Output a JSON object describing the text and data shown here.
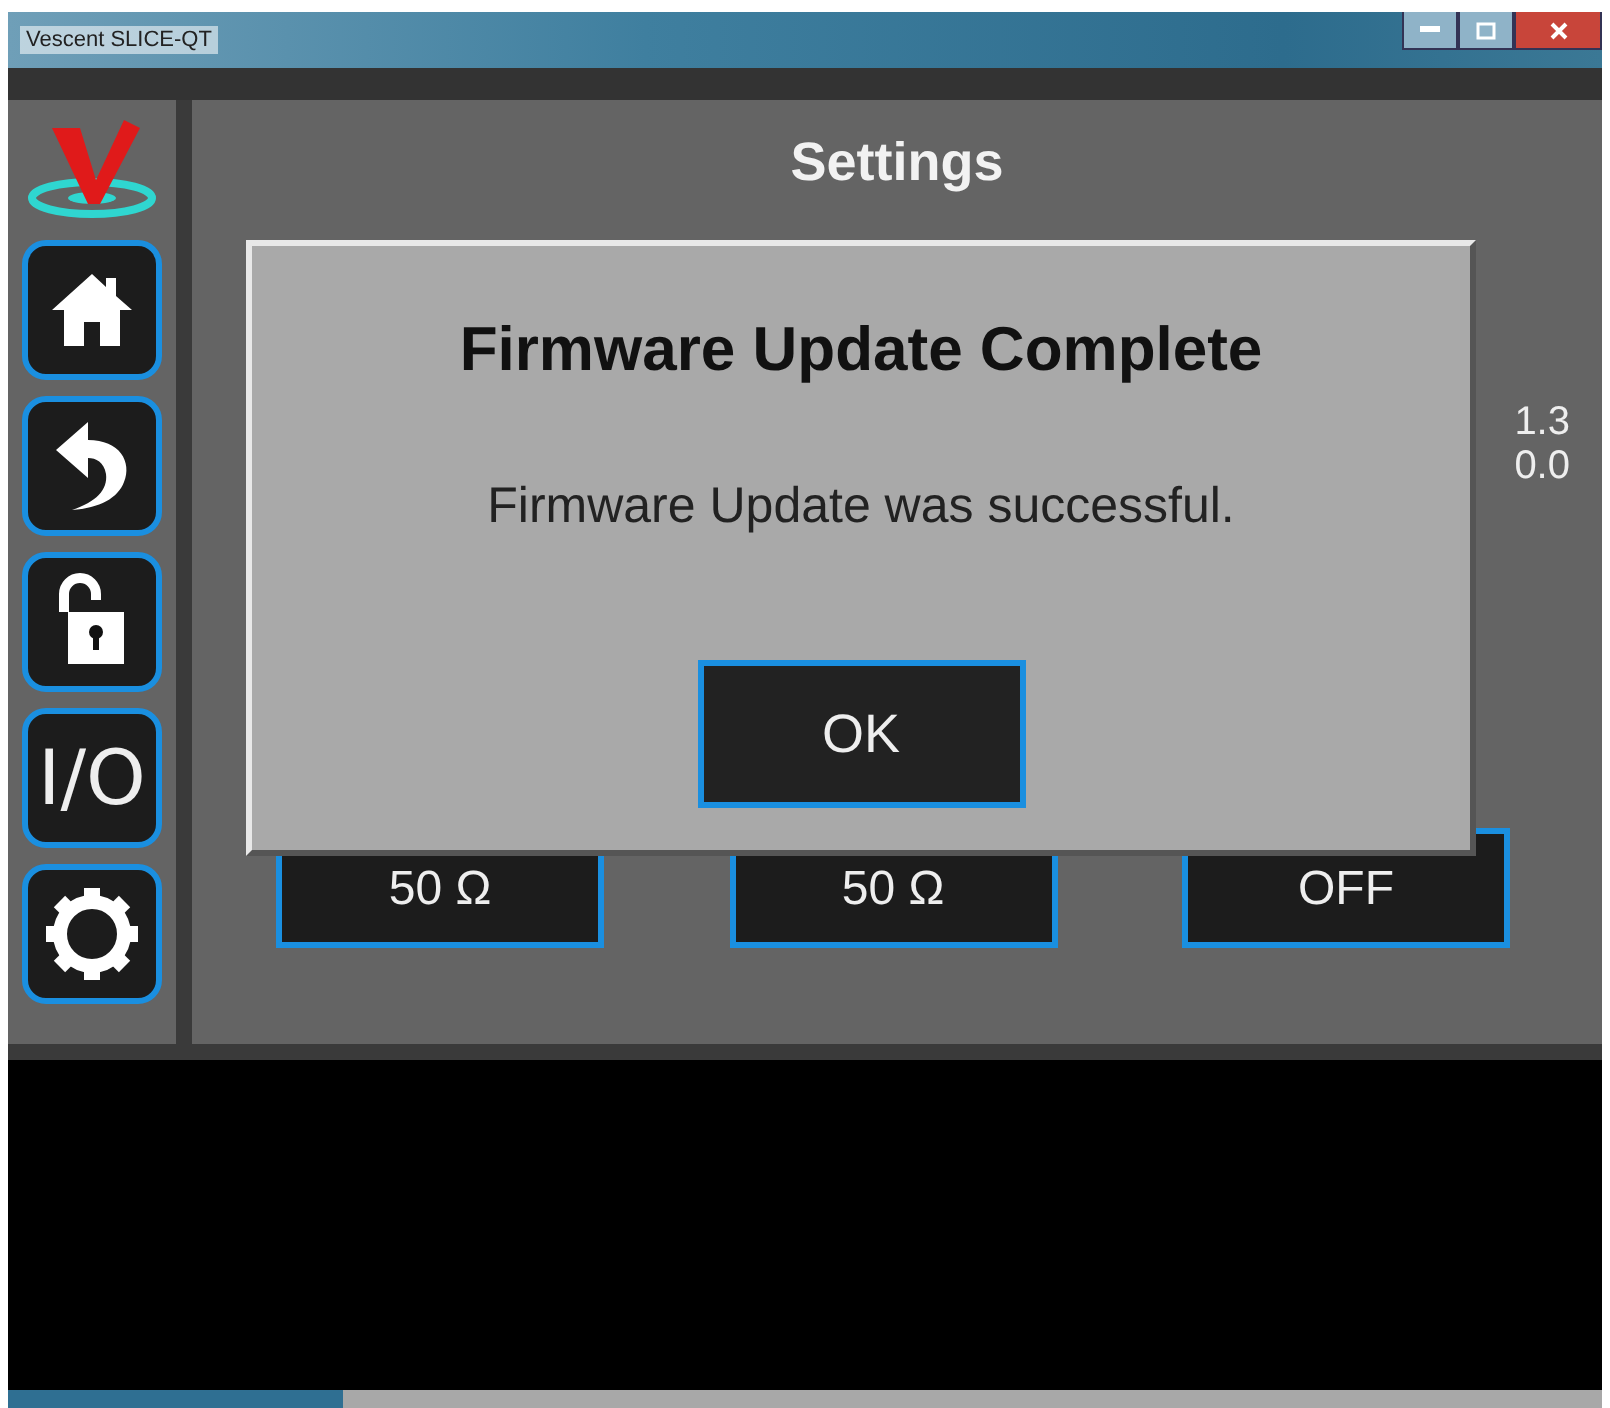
{
  "window": {
    "title": "Vescent SLICE-QT"
  },
  "sidebar": {
    "items": [
      {
        "kind": "home"
      },
      {
        "kind": "back"
      },
      {
        "kind": "unlock"
      },
      {
        "kind": "io",
        "label": "I/O"
      },
      {
        "kind": "settings"
      }
    ]
  },
  "page": {
    "title": "Settings",
    "values": [
      "1.3",
      "0.0"
    ],
    "buttons": [
      {
        "label": "50 Ω"
      },
      {
        "label": "50 Ω"
      },
      {
        "label": "OFF"
      }
    ]
  },
  "dialog": {
    "title": "Firmware Update Complete",
    "message": "Firmware Update was successful.",
    "button": "OK"
  }
}
